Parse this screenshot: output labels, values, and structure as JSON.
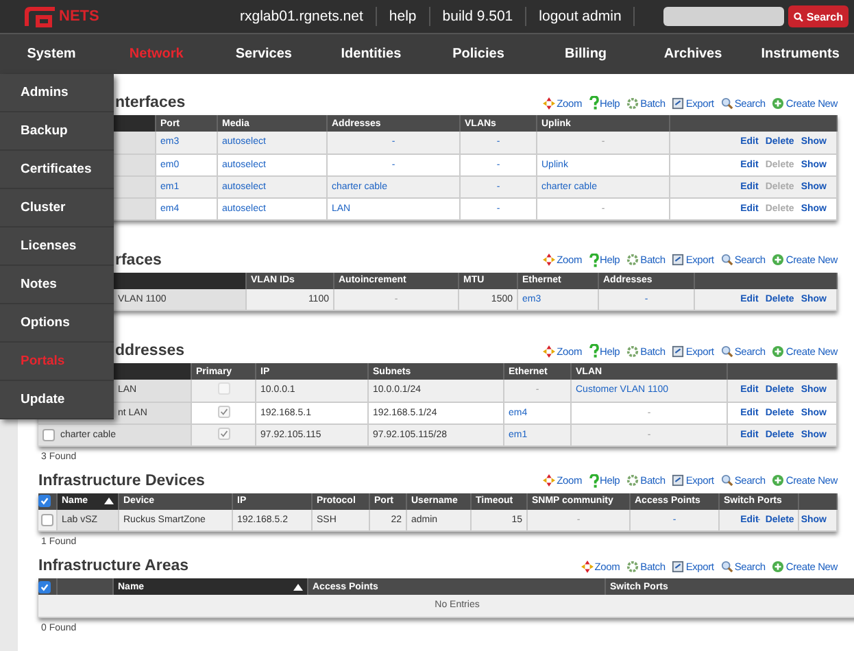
{
  "header": {
    "logo_text": "NETS",
    "links": [
      "rxglab01.rgnets.net",
      "help",
      "build 9.501",
      "logout admin"
    ],
    "search_button": "Search"
  },
  "nav": [
    {
      "label": "System",
      "selected": false
    },
    {
      "label": "Network",
      "selected": true
    },
    {
      "label": "Services",
      "selected": false
    },
    {
      "label": "Identities",
      "selected": false
    },
    {
      "label": "Policies",
      "selected": false
    },
    {
      "label": "Billing",
      "selected": false
    },
    {
      "label": "Archives",
      "selected": false
    },
    {
      "label": "Instruments",
      "selected": false
    }
  ],
  "system_menu": [
    {
      "label": "Admins",
      "selected": false
    },
    {
      "label": "Backup",
      "selected": false
    },
    {
      "label": "Certificates",
      "selected": false
    },
    {
      "label": "Cluster",
      "selected": false
    },
    {
      "label": "Licenses",
      "selected": false
    },
    {
      "label": "Notes",
      "selected": false
    },
    {
      "label": "Options",
      "selected": false
    },
    {
      "label": "Portals",
      "selected": true
    },
    {
      "label": "Update",
      "selected": false
    }
  ],
  "sections": [
    {
      "title": "nterfaces",
      "toolbar": [
        {
          "kind": "zoom",
          "label": "Zoom"
        },
        {
          "kind": "help",
          "label": "Help"
        },
        {
          "kind": "batch",
          "label": "Batch"
        },
        {
          "kind": "export",
          "label": "Export"
        },
        {
          "kind": "search",
          "label": "Search"
        },
        {
          "kind": "create",
          "label": "Create New"
        }
      ],
      "columns": [
        {
          "sorted": true
        },
        {
          "label": "Port",
          "sorted": false
        },
        {
          "label": "Media",
          "sorted": false
        },
        {
          "label": "Addresses",
          "sorted": false
        },
        {
          "label": "VLANs",
          "sorted": false
        },
        {
          "label": "Uplink",
          "sorted": false
        }
      ],
      "rows": [
        {
          "cells": [
            null,
            {
              "text": "em3",
              "kind": "link"
            },
            {
              "text": "autoselect",
              "kind": "link"
            },
            {
              "text": "-",
              "kind": "link_none"
            },
            {
              "text": "-",
              "kind": "link_none"
            },
            {
              "text": "-",
              "kind": "none"
            }
          ],
          "actions": {
            "edit": "Edit",
            "delete": "Delete",
            "show": "Show",
            "delete_disabled": false
          }
        },
        {
          "cells": [
            null,
            {
              "text": "em0",
              "kind": "link"
            },
            {
              "text": "autoselect",
              "kind": "link"
            },
            {
              "text": "-",
              "kind": "link_none"
            },
            {
              "text": "-",
              "kind": "link_none"
            },
            {
              "text": "Uplink",
              "kind": "link"
            }
          ],
          "actions": {
            "edit": "Edit",
            "delete": "Delete",
            "show": "Show",
            "delete_disabled": true
          }
        },
        {
          "cells": [
            null,
            {
              "text": "em1",
              "kind": "link"
            },
            {
              "text": "autoselect",
              "kind": "link"
            },
            {
              "text": "charter cable",
              "kind": "link"
            },
            {
              "text": "-",
              "kind": "link_none"
            },
            {
              "text": "charter cable",
              "kind": "link"
            }
          ],
          "actions": {
            "edit": "Edit",
            "delete": "Delete",
            "show": "Show",
            "delete_disabled": true
          }
        },
        {
          "cells": [
            null,
            {
              "text": "em4",
              "kind": "link"
            },
            {
              "text": "autoselect",
              "kind": "link"
            },
            {
              "text": "LAN",
              "kind": "link"
            },
            {
              "text": "-",
              "kind": "link_none"
            },
            {
              "text": "-",
              "kind": "none"
            }
          ],
          "actions": {
            "edit": "Edit",
            "delete": "Delete",
            "show": "Show",
            "delete_disabled": true
          }
        }
      ]
    },
    {
      "title": "rfaces",
      "toolbar": [
        {
          "kind": "zoom",
          "label": "Zoom"
        },
        {
          "kind": "help",
          "label": "Help"
        },
        {
          "kind": "batch",
          "label": "Batch"
        },
        {
          "kind": "export",
          "label": "Export"
        },
        {
          "kind": "search",
          "label": "Search"
        },
        {
          "kind": "create",
          "label": "Create New"
        }
      ],
      "columns": [
        {
          "sorted": true
        },
        {
          "label": "VLAN IDs",
          "sorted": false
        },
        {
          "label": "Autoincrement",
          "sorted": false
        },
        {
          "label": "MTU",
          "sorted": false
        },
        {
          "label": "Ethernet",
          "sorted": false
        },
        {
          "label": "Addresses",
          "sorted": false
        }
      ],
      "rows": [
        {
          "cells": [
            {
              "text": "VLAN 1100",
              "kind": "text"
            },
            {
              "text": "1100",
              "kind": "number"
            },
            {
              "text": "-",
              "kind": "none"
            },
            {
              "text": "1500",
              "kind": "number"
            },
            {
              "text": "em3",
              "kind": "link"
            },
            {
              "text": "-",
              "kind": "link_none"
            }
          ],
          "actions": {
            "edit": "Edit",
            "delete": "Delete",
            "show": "Show",
            "delete_disabled": false
          }
        }
      ]
    },
    {
      "title": "ddresses",
      "found": "3 Found",
      "toolbar": [
        {
          "kind": "zoom",
          "label": "Zoom"
        },
        {
          "kind": "help",
          "label": "Help"
        },
        {
          "kind": "batch",
          "label": "Batch"
        },
        {
          "kind": "export",
          "label": "Export"
        },
        {
          "kind": "search",
          "label": "Search"
        },
        {
          "kind": "create",
          "label": "Create New"
        }
      ],
      "columns": [
        {
          "sorted": true
        },
        {
          "label": "Primary",
          "sorted": false
        },
        {
          "label": "IP",
          "sorted": false
        },
        {
          "label": "Subnets",
          "sorted": false
        },
        {
          "label": "Ethernet",
          "sorted": false
        },
        {
          "label": "VLAN",
          "sorted": false
        }
      ],
      "rows": [
        {
          "cells": [
            {
              "text": "LAN",
              "kind": "text"
            },
            {
              "kind": "check",
              "checked": false
            },
            {
              "text": "10.0.0.1",
              "kind": "text"
            },
            {
              "text": "10.0.0.1/24",
              "kind": "text"
            },
            {
              "text": "-",
              "kind": "none"
            },
            {
              "text": "Customer VLAN 1100",
              "kind": "link"
            }
          ],
          "actions": {
            "edit": "Edit",
            "delete": "Delete",
            "show": "Show",
            "delete_disabled": false
          }
        },
        {
          "cells": [
            {
              "text": "nt LAN",
              "kind": "text"
            },
            {
              "kind": "check",
              "checked": true
            },
            {
              "text": "192.168.5.1",
              "kind": "text"
            },
            {
              "text": "192.168.5.1/24",
              "kind": "text"
            },
            {
              "text": "em4",
              "kind": "link"
            },
            {
              "text": "-",
              "kind": "none"
            }
          ],
          "actions": {
            "edit": "Edit",
            "delete": "Delete",
            "show": "Show",
            "delete_disabled": false
          }
        },
        {
          "checked": false,
          "cells": [
            {
              "text": "charter cable",
              "kind": "text"
            },
            {
              "kind": "check",
              "checked": true
            },
            {
              "text": "97.92.105.115",
              "kind": "text"
            },
            {
              "text": "97.92.105.115/28",
              "kind": "text"
            },
            {
              "text": "em1",
              "kind": "link"
            },
            {
              "text": "-",
              "kind": "none"
            }
          ],
          "actions": {
            "edit": "Edit",
            "delete": "Delete",
            "show": "Show",
            "delete_disabled": false
          }
        }
      ]
    },
    {
      "title": "Infrastructure Devices",
      "found": "1 Found",
      "select_all": {
        "checked": true
      },
      "toolbar": [
        {
          "kind": "zoom",
          "label": "Zoom"
        },
        {
          "kind": "help",
          "label": "Help"
        },
        {
          "kind": "batch",
          "label": "Batch"
        },
        {
          "kind": "export",
          "label": "Export"
        },
        {
          "kind": "search",
          "label": "Search"
        },
        {
          "kind": "create",
          "label": "Create New"
        }
      ],
      "columns": [
        {
          "label": "Name",
          "sorted": true
        },
        {
          "label": "Device",
          "sorted": false
        },
        {
          "label": "IP",
          "sorted": false
        },
        {
          "label": "Protocol",
          "sorted": false
        },
        {
          "label": "Port",
          "sorted": false
        },
        {
          "label": "Username",
          "sorted": false
        },
        {
          "label": "Timeout",
          "sorted": false
        },
        {
          "label": "SNMP community",
          "sorted": false
        },
        {
          "label": "Access Points",
          "sorted": false
        },
        {
          "label": "Switch Ports",
          "sorted": false
        }
      ],
      "rows": [
        {
          "checked": false,
          "cells": [
            {
              "text": "Lab vSZ",
              "kind": "text"
            },
            {
              "text": "Ruckus SmartZone",
              "kind": "text"
            },
            {
              "text": "192.168.5.2",
              "kind": "text"
            },
            {
              "text": "SSH",
              "kind": "text"
            },
            {
              "text": "22",
              "kind": "number"
            },
            {
              "text": "admin",
              "kind": "text"
            },
            {
              "text": "15",
              "kind": "number"
            },
            {
              "text": "-",
              "kind": "none"
            },
            {
              "text": "-",
              "kind": "link_none"
            },
            {
              "text": "-",
              "kind": "link_none"
            }
          ],
          "actions": {
            "edit": "Edit",
            "delete": "Delete",
            "show": "Show",
            "delete_disabled": false
          }
        }
      ]
    },
    {
      "title": "Infrastructure Areas",
      "found": "0 Found",
      "select_all": {
        "checked": true
      },
      "empty": "No Entries",
      "toolbar": [
        {
          "kind": "zoom",
          "label": "Zoom"
        },
        {
          "kind": "batch",
          "label": "Batch"
        },
        {
          "kind": "export",
          "label": "Export"
        },
        {
          "kind": "search",
          "label": "Search"
        },
        {
          "kind": "create",
          "label": "Create New"
        }
      ],
      "columns": [
        {
          "sorted": false
        },
        {
          "label": "Name",
          "sorted": true
        },
        {
          "label": "Access Points",
          "sorted": false
        },
        {
          "label": "Switch Ports",
          "sorted": false
        }
      ]
    }
  ]
}
